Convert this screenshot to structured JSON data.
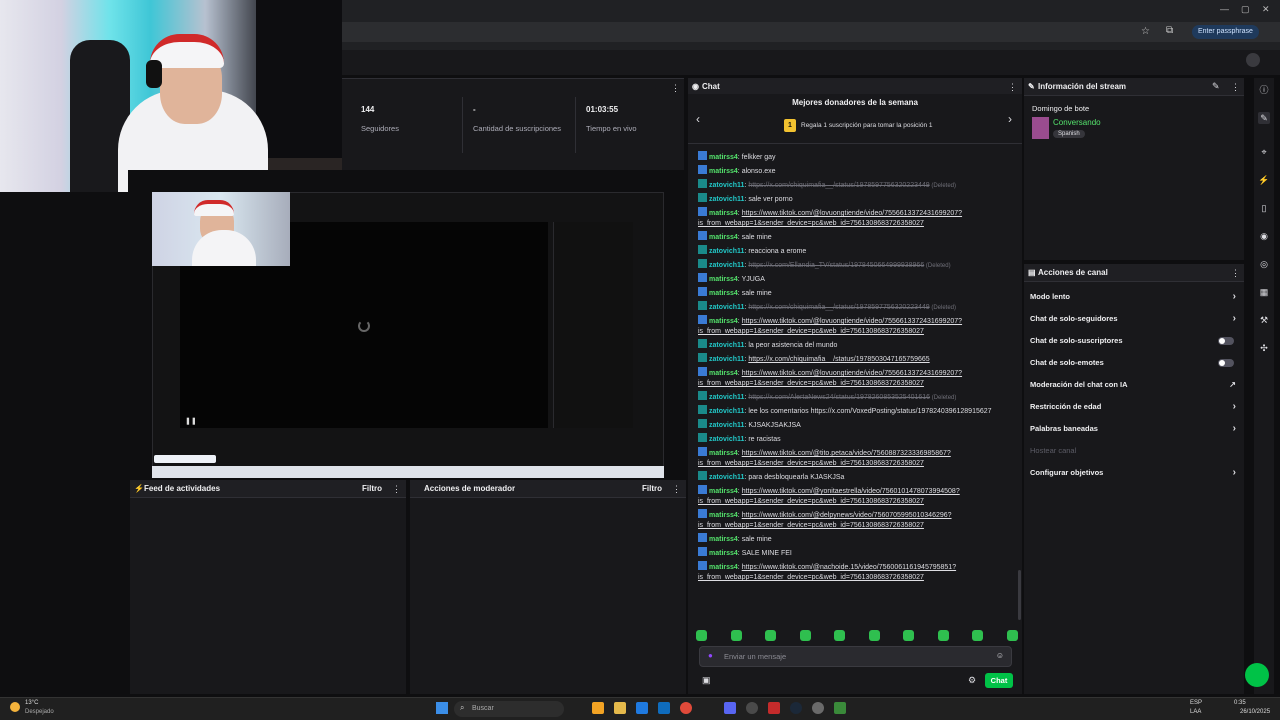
{
  "browser": {
    "passphrase_label": "Enter passphrase"
  },
  "stats": {
    "followers_value": "144",
    "followers_label": "Seguidores",
    "subs_value": "-",
    "subs_label": "Cantidad de suscripciones",
    "live_value": "01:03:55",
    "live_label": "Tiempo en vivo"
  },
  "panels": {
    "feed_title": "Feed de actividades",
    "feed_filter": "Filtro",
    "mod_title": "Acciones de moderador",
    "mod_filter": "Filtro"
  },
  "chat": {
    "title": "Chat",
    "donors_title": "Mejores donadores de la semana",
    "donors_rank": "1",
    "donors_cta": "Regala 1 suscripción para tomar la posición 1",
    "input_placeholder": "Enviar un mensaje",
    "send_label": "Chat",
    "messages": [
      {
        "user": "matirss4",
        "color": "g",
        "text": "felkker gay",
        "kind": "text"
      },
      {
        "user": "matirss4",
        "color": "g",
        "text": "alonso.exe",
        "kind": "text"
      },
      {
        "user": "zatovich11",
        "color": "t",
        "text": "https://x.com/chiquimafia__/status/1978597756320223449",
        "kind": "deleted"
      },
      {
        "user": "zatovich11",
        "color": "t",
        "text": "sale ver porno",
        "kind": "text"
      },
      {
        "user": "matirss4",
        "color": "g",
        "text": "https://www.tiktok.com/@lovuongtiende/video/7556613372431699207?is_from_webapp=1&sender_device=pc&web_id=7561308683726358027",
        "kind": "link"
      },
      {
        "user": "matirss4",
        "color": "g",
        "text": "sale mine",
        "kind": "text"
      },
      {
        "user": "zatovich11",
        "color": "t",
        "text": "reacciona a erome",
        "kind": "text"
      },
      {
        "user": "zatovich11",
        "color": "t",
        "text": "https://x.com/Ellandia_TV/status/1978450664999938966",
        "kind": "deleted"
      },
      {
        "user": "matirss4",
        "color": "g",
        "text": "YJUGA",
        "kind": "text"
      },
      {
        "user": "matirss4",
        "color": "g",
        "text": "sale mine",
        "kind": "text"
      },
      {
        "user": "zatovich11",
        "color": "t",
        "text": "https://x.com/chiquimafia__/status/1978597756320223449",
        "kind": "deleted"
      },
      {
        "user": "matirss4",
        "color": "g",
        "text": "https://www.tiktok.com/@lovuongtiende/video/7556613372431699207?is_from_webapp=1&sender_device=pc&web_id=7561308683726358027",
        "kind": "link"
      },
      {
        "user": "zatovich11",
        "color": "t",
        "text": "la peor asistencia del mundo",
        "kind": "text"
      },
      {
        "user": "zatovich11",
        "color": "t",
        "text": "https://x.com/chiquimafia__/status/1978503047165759665",
        "kind": "link"
      },
      {
        "user": "matirss4",
        "color": "g",
        "text": "https://www.tiktok.com/@lovuongtiende/video/7556613372431699207?is_from_webapp=1&sender_device=pc&web_id=7561308683726358027",
        "kind": "link"
      },
      {
        "user": "zatovich11",
        "color": "t",
        "text": "https://x.com/AlertaNews24/status/1978260853525401616",
        "kind": "deleted"
      },
      {
        "user": "zatovich11",
        "color": "t",
        "text": "lee los comentarios https://x.com/VoxedPosting/status/1978240396128915627",
        "kind": "text"
      },
      {
        "user": "zatovich11",
        "color": "t",
        "text": "KJSAKJSAKJSA",
        "kind": "text"
      },
      {
        "user": "zatovich11",
        "color": "t",
        "text": "re racistas",
        "kind": "text"
      },
      {
        "user": "matirss4",
        "color": "g",
        "text": "https://www.tiktok.com/@tito.petaca/video/7560887323336985867?is_from_webapp=1&sender_device=pc&web_id=7561308683726358027",
        "kind": "link"
      },
      {
        "user": "zatovich11",
        "color": "t",
        "text": "para desbloquearla KJASKJSa",
        "kind": "text"
      },
      {
        "user": "matirss4",
        "color": "g",
        "text": "https://www.tiktok.com/@yonitaestrella/video/7560101478073994508?is_from_webapp=1&sender_device=pc&web_id=7561308683726358027",
        "kind": "link"
      },
      {
        "user": "matirss4",
        "color": "g",
        "text": "https://www.tiktok.com/@delpynews/video/7560705995010346296?is_from_webapp=1&sender_device=pc&web_id=7561308683726358027",
        "kind": "link"
      },
      {
        "user": "matirss4",
        "color": "g",
        "text": "sale mine",
        "kind": "text"
      },
      {
        "user": "matirss4",
        "color": "g",
        "text": "SALE MINE FEI",
        "kind": "text"
      },
      {
        "user": "matirss4",
        "color": "g",
        "text": "https://www.tiktok.com/@nachoide.15/video/7560061161945795851?is_from_webapp=1&sender_device=pc&web_id=7561308683726358027",
        "kind": "link"
      }
    ],
    "deleted_tag": "(Deleted)"
  },
  "stream_info": {
    "title": "Información del stream",
    "stream_name": "Domingo de bote",
    "category": "Conversando",
    "tag": "Spanish"
  },
  "channel_actions": {
    "title": "Acciones de canal",
    "items": [
      {
        "label": "Modo lento",
        "control": "chevron"
      },
      {
        "label": "Chat de solo-seguidores",
        "control": "chevron"
      },
      {
        "label": "Chat de solo-suscriptores",
        "control": "toggle"
      },
      {
        "label": "Chat de solo-emotes",
        "control": "toggle"
      },
      {
        "label": "Moderación del chat con IA",
        "control": "external"
      },
      {
        "label": "Restricción de edad",
        "control": "chevron"
      },
      {
        "label": "Palabras baneadas",
        "control": "chevron"
      },
      {
        "label": "Hostear canal",
        "control": "disabled"
      },
      {
        "label": "Configurar objetivos",
        "control": "chevron"
      }
    ]
  },
  "taskbar": {
    "weather_temp": "13°C",
    "weather_desc": "Despejado",
    "search_label": "Buscar",
    "lang": "ESP",
    "lang2": "LAA",
    "time": "0:35",
    "date": "26/10/2025"
  },
  "colors": {
    "accent_green": "#00c247",
    "user_green": "#54e36c",
    "user_teal": "#22c7c7"
  }
}
